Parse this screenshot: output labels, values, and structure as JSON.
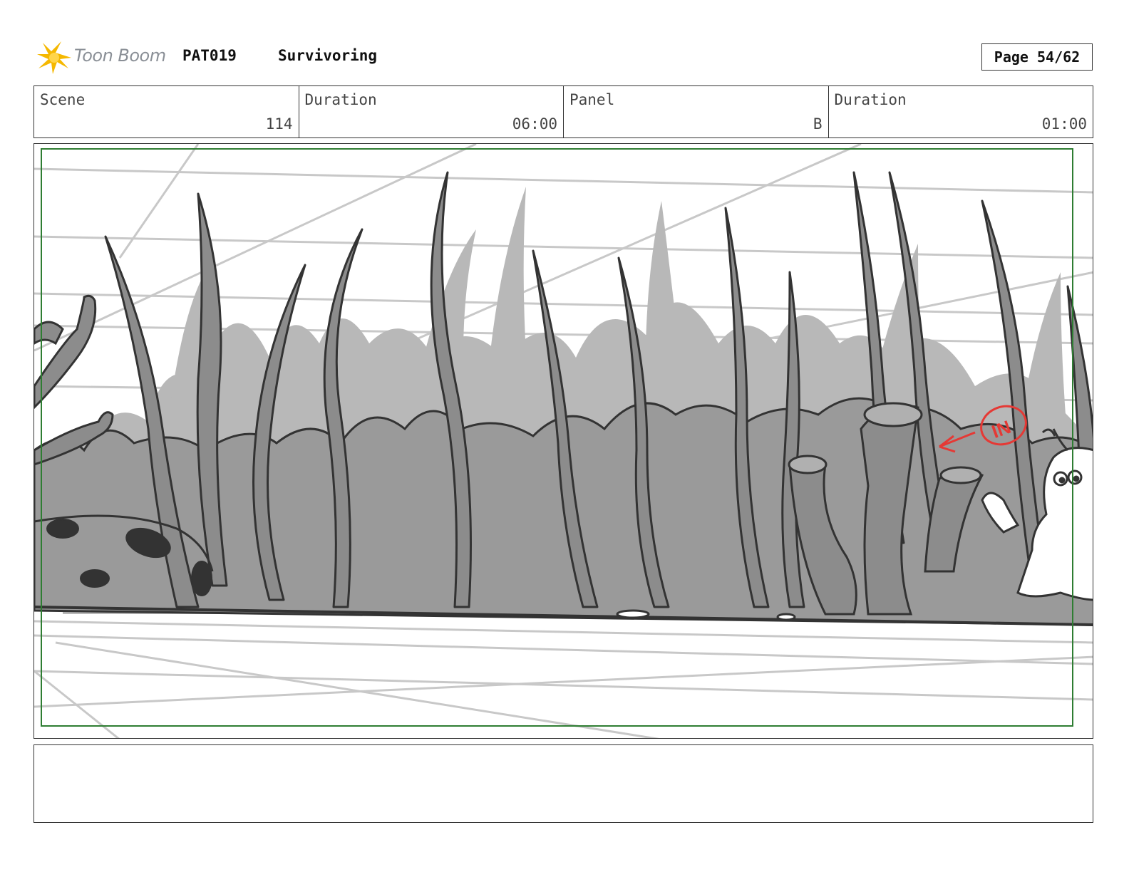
{
  "header": {
    "logo_text": "Toon Boom",
    "project_code": "PAT019",
    "project_title": "Survivoring",
    "page": "Page 54/62"
  },
  "info": {
    "scene_label": "Scene",
    "scene_value": "114",
    "scene_duration_label": "Duration",
    "scene_duration_value": "06:00",
    "panel_label": "Panel",
    "panel_value": "B",
    "panel_duration_label": "Duration",
    "panel_duration_value": "01:00"
  },
  "panel": {
    "annotation": "IN",
    "colors": {
      "safe_frame": "#2e7d32",
      "annotation": "#e53935",
      "foreground_plants": "#8c8c8c",
      "background_plants": "#b8b8b8",
      "construction_lines": "#c8c8c8"
    }
  },
  "notes": {
    "action": ""
  }
}
